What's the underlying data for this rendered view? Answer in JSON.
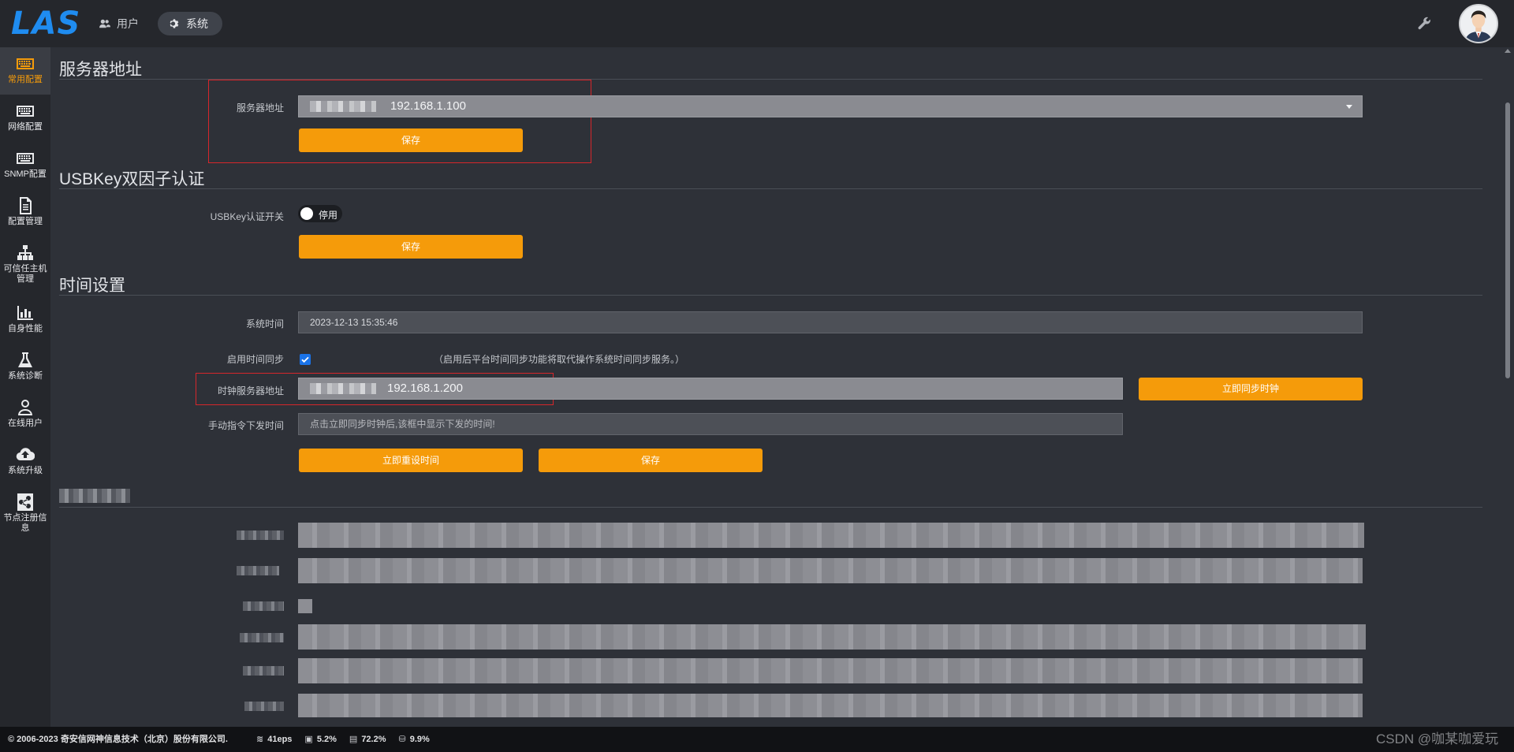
{
  "app": {
    "logo": "LAS"
  },
  "top_nav": {
    "tabs": [
      {
        "label": "用户",
        "icon": "users-icon"
      },
      {
        "label": "系统",
        "icon": "gear-icon"
      }
    ]
  },
  "sidebar": {
    "items": [
      {
        "label": "常用配置",
        "icon": "keyboard-icon",
        "active": true
      },
      {
        "label": "网络配置",
        "icon": "keyboard-icon"
      },
      {
        "label": "SNMP配置",
        "icon": "keyboard-icon"
      },
      {
        "label": "配置管理",
        "icon": "document-icon"
      },
      {
        "label": "可信任主机管理",
        "icon": "sitemap-icon"
      },
      {
        "label": "自身性能",
        "icon": "bar-chart-icon"
      },
      {
        "label": "系统诊断",
        "icon": "flask-icon"
      },
      {
        "label": "在线用户",
        "icon": "user-icon"
      },
      {
        "label": "系统升级",
        "icon": "cloud-upload-icon"
      },
      {
        "label": "节点注册信息",
        "icon": "share-icon"
      }
    ]
  },
  "server_section": {
    "title": "服务器地址",
    "field_label": "服务器地址",
    "value": "192.168.1.100",
    "save_label": "保存"
  },
  "usbkey_section": {
    "title": "USBKey双因子认证",
    "field_label": "USBKey认证开关",
    "toggle_label": "停用",
    "save_label": "保存"
  },
  "time_section": {
    "title": "时间设置",
    "system_time_label": "系统时间",
    "system_time_value": "2023-12-13 15:35:46",
    "sync_label": "启用时间同步",
    "sync_checked": true,
    "sync_hint": "（启用后平台时间同步功能将取代操作系统时间同步服务。）",
    "ntp_label": "时钟服务器地址",
    "ntp_value": "192.168.1.200",
    "sync_now_label": "立即同步时钟",
    "manual_label": "手动指令下发时间",
    "manual_placeholder": "点击立即同步时钟后,该框中显示下发的时间!",
    "reset_label": "立即重设时间",
    "save_label": "保存"
  },
  "footer": {
    "copyright": "© 2006-2023 奇安信网神信息技术（北京）股份有限公司.",
    "eps": "41eps",
    "cpu": "5.2%",
    "mem": "72.2%",
    "disk": "9.9%"
  },
  "watermark": "CSDN @咖某咖爱玩",
  "colors": {
    "accent": "#f59b0a",
    "brand": "#1f8cf0",
    "highlight_box": "#d6262b"
  }
}
